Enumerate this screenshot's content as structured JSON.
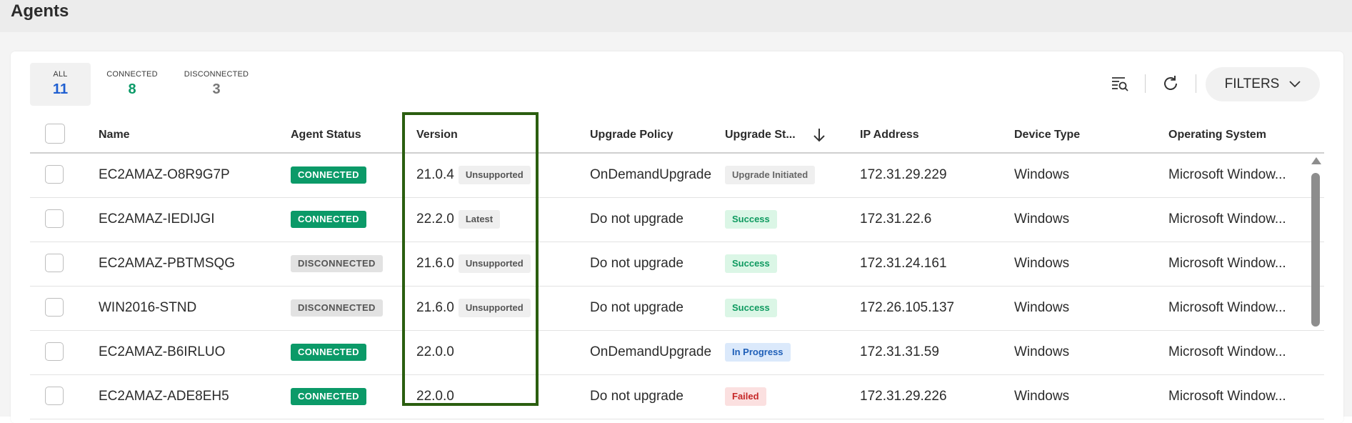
{
  "page": {
    "title": "Agents"
  },
  "summary": {
    "all": {
      "label": "ALL",
      "count": "11",
      "color": "#1f5fd1"
    },
    "connected": {
      "label": "CONNECTED",
      "count": "8",
      "color": "#0b9a68"
    },
    "disconnected": {
      "label": "DISCONNECTED",
      "count": "3",
      "color": "#777777"
    }
  },
  "toolbar": {
    "search_icon": "list-search-icon",
    "refresh_icon": "refresh-icon",
    "filters_label": "FILTERS"
  },
  "table": {
    "columns": [
      "Name",
      "Agent Status",
      "Version",
      "Upgrade Policy",
      "Upgrade St...",
      "IP Address",
      "Device Type",
      "Operating System"
    ],
    "rows": [
      {
        "name": "EC2AMAZ-O8R9G7P",
        "status": "CONNECTED",
        "version": "21.0.4",
        "version_tag": "Unsupported",
        "policy": "OnDemandUpgrade",
        "upgrade_status": "Upgrade Initiated",
        "ip": "172.31.29.229",
        "device": "Windows",
        "os": "Microsoft Window..."
      },
      {
        "name": "EC2AMAZ-IEDIJGI",
        "status": "CONNECTED",
        "version": "22.2.0",
        "version_tag": "Latest",
        "policy": "Do not upgrade",
        "upgrade_status": "Success",
        "ip": "172.31.22.6",
        "device": "Windows",
        "os": "Microsoft Window..."
      },
      {
        "name": "EC2AMAZ-PBTMSQG",
        "status": "DISCONNECTED",
        "version": "21.6.0",
        "version_tag": "Unsupported",
        "policy": "Do not upgrade",
        "upgrade_status": "Success",
        "ip": "172.31.24.161",
        "device": "Windows",
        "os": "Microsoft Window..."
      },
      {
        "name": "WIN2016-STND",
        "status": "DISCONNECTED",
        "version": "21.6.0",
        "version_tag": "Unsupported",
        "policy": "Do not upgrade",
        "upgrade_status": "Success",
        "ip": "172.26.105.137",
        "device": "Windows",
        "os": "Microsoft Window..."
      },
      {
        "name": "EC2AMAZ-B6IRLUO",
        "status": "CONNECTED",
        "version": "22.0.0",
        "version_tag": "",
        "policy": "OnDemandUpgrade",
        "upgrade_status": "In Progress",
        "ip": "172.31.31.59",
        "device": "Windows",
        "os": "Microsoft Window..."
      },
      {
        "name": "EC2AMAZ-ADE8EH5",
        "status": "CONNECTED",
        "version": "22.0.0",
        "version_tag": "",
        "policy": "Do not upgrade",
        "upgrade_status": "Failed",
        "ip": "172.31.29.226",
        "device": "Windows",
        "os": "Microsoft Window..."
      }
    ]
  },
  "colors": {
    "connected": "#0b9a68",
    "highlight": "#2b5e10"
  }
}
